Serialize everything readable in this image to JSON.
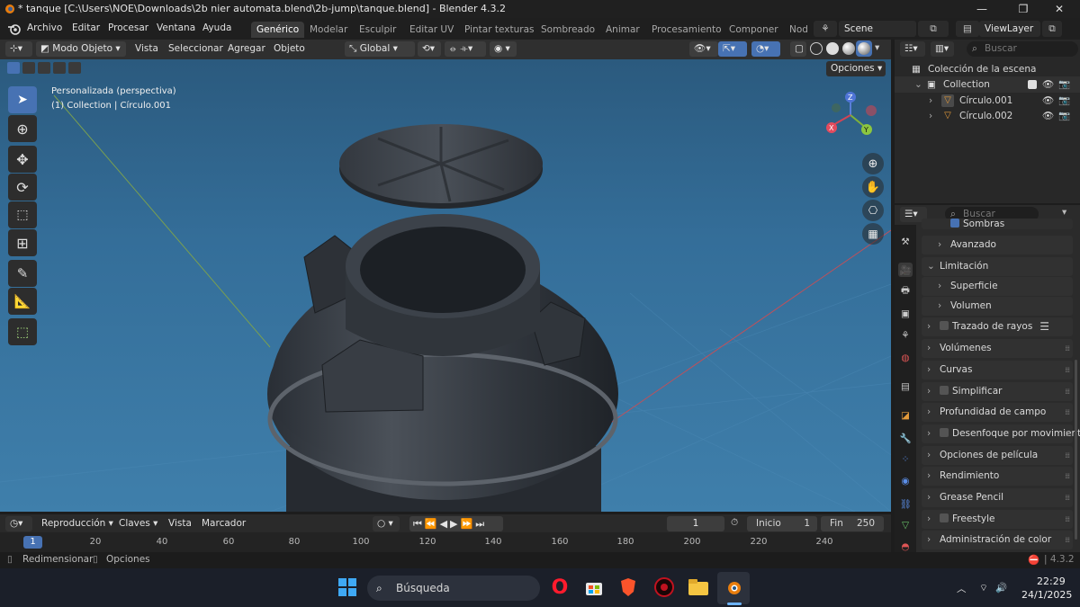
{
  "window": {
    "title": "* tanque [C:\\Users\\NOE\\Downloads\\2b nier automata.blend\\2b-jump\\tanque.blend] - Blender 4.3.2",
    "controls": [
      "—",
      "❐",
      "✕"
    ]
  },
  "menu": {
    "items": [
      "Archivo",
      "Editar",
      "Procesar",
      "Ventana",
      "Ayuda"
    ]
  },
  "workspaces": [
    "Genérico",
    "Modelar",
    "Esculpir",
    "Editar UV",
    "Pintar texturas",
    "Sombreado",
    "Animar",
    "Procesamiento",
    "Componer",
    "Nod"
  ],
  "active_workspace": "Genérico",
  "scene": {
    "name": "Scene",
    "view_layer": "ViewLayer"
  },
  "viewport_header": {
    "mode": "Modo Objeto",
    "menus": [
      "Vista",
      "Seleccionar",
      "Agregar",
      "Objeto"
    ],
    "transform_orientation": "Global",
    "options_label": "Opciones"
  },
  "viewport": {
    "view_name": "Personalizada (perspectiva)",
    "collection_info": "(1) Collection | Círculo.001",
    "gizmo_axes": {
      "z": "Z",
      "y": "Y",
      "x": "X"
    }
  },
  "outliner": {
    "search_placeholder": "Buscar",
    "root": "Colección de la escena",
    "collection": "Collection",
    "objects": [
      "Círculo.001",
      "Círculo.002"
    ]
  },
  "properties": {
    "search_placeholder": "Buscar",
    "partial_row": "Sombras",
    "rows": [
      {
        "label": "Avanzado",
        "indent": 1,
        "checkbox": false
      },
      {
        "label": "Limitación",
        "indent": 0,
        "checkbox": false,
        "expanded": true
      },
      {
        "label": "Superficie",
        "indent": 1,
        "checkbox": false
      },
      {
        "label": "Volumen",
        "indent": 1,
        "checkbox": false
      },
      {
        "label": "Trazado de rayos",
        "indent": 0,
        "checkbox": true
      },
      {
        "label": "Volúmenes",
        "indent": 0,
        "checkbox": false
      },
      {
        "label": "Curvas",
        "indent": 0,
        "checkbox": false
      },
      {
        "label": "Simplificar",
        "indent": 0,
        "checkbox": true
      },
      {
        "label": "Profundidad de campo",
        "indent": 0,
        "checkbox": false
      },
      {
        "label": "Desenfoque por movimiento",
        "indent": 0,
        "checkbox": true
      },
      {
        "label": "Opciones de película",
        "indent": 0,
        "checkbox": false
      },
      {
        "label": "Rendimiento",
        "indent": 0,
        "checkbox": false
      },
      {
        "label": "Grease Pencil",
        "indent": 0,
        "checkbox": false
      },
      {
        "label": "Freestyle",
        "indent": 0,
        "checkbox": true
      },
      {
        "label": "Administración de color",
        "indent": 0,
        "checkbox": false
      }
    ]
  },
  "timeline": {
    "menus": [
      "Reproducción",
      "Claves",
      "Vista",
      "Marcador"
    ],
    "current_frame": "1",
    "start_label": "Inicio",
    "start": "1",
    "end_label": "Fin",
    "end": "250",
    "ruler_marker": "1",
    "ticks": [
      "20",
      "40",
      "60",
      "80",
      "100",
      "120",
      "140",
      "160",
      "180",
      "200",
      "220",
      "240"
    ]
  },
  "status": {
    "left": [
      "Redimensionar",
      "Opciones"
    ],
    "version": "4.3.2"
  },
  "taskbar": {
    "search": "Búsqueda",
    "time": "22:29",
    "date": "24/1/2025"
  },
  "colors": {
    "accent": "#4772b3",
    "viewport_sky": "#3a78a6",
    "object_orange": "#e39a3a"
  }
}
